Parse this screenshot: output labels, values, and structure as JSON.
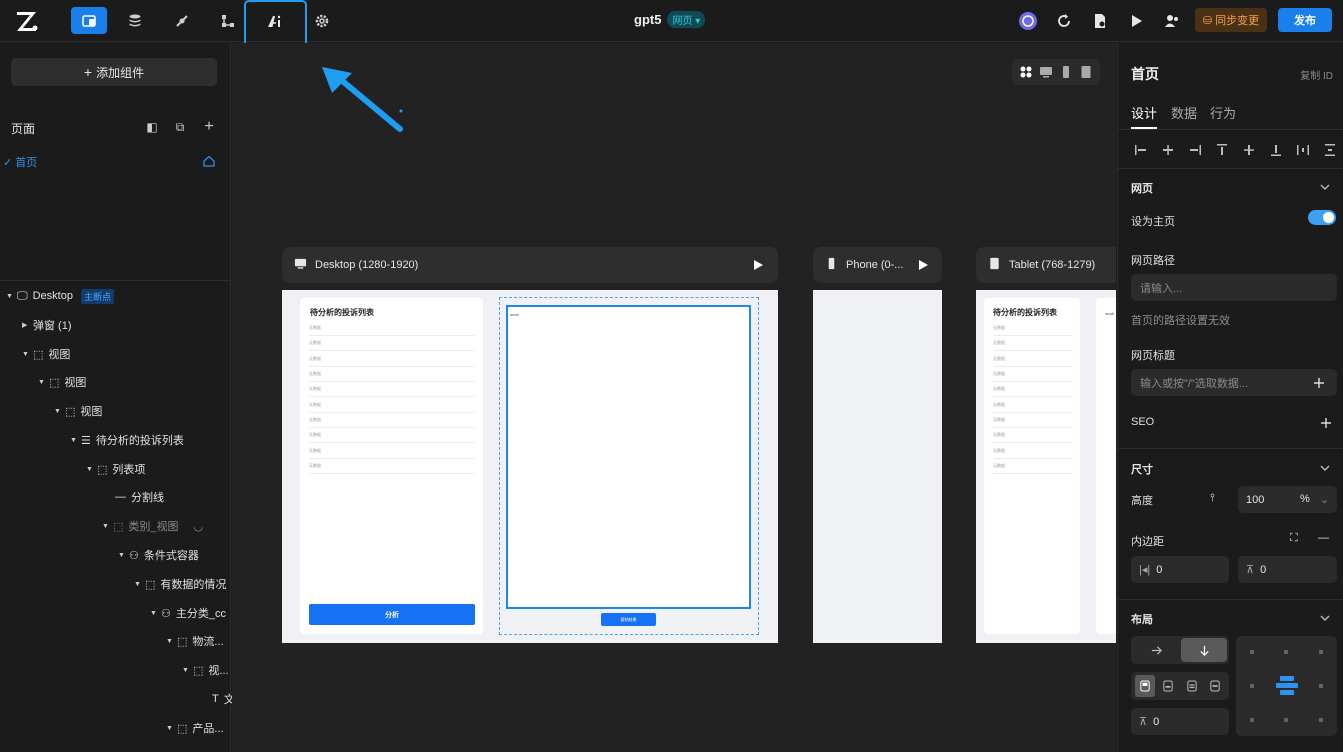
{
  "topbar": {
    "title": "gpt5",
    "title_badge": "网页",
    "sync_label": "同步变更",
    "publish_label": "发布",
    "tool_icons": [
      "pages-icon",
      "database-icon",
      "plugin-icon",
      "workflow-icon",
      "ai-icon",
      "settings-icon"
    ]
  },
  "left": {
    "add_component_label": "添加组件",
    "pages_heading": "页面",
    "current_page": "首页",
    "tree": [
      {
        "label": "Desktop",
        "badge": "主断点"
      },
      {
        "label": "弹窗 (1)"
      },
      {
        "label": "视图"
      },
      {
        "label": "视图"
      },
      {
        "label": "视图"
      },
      {
        "label": "待分析的投诉列表"
      },
      {
        "label": "列表项"
      },
      {
        "label": "分割线"
      },
      {
        "label": "类别_视图"
      },
      {
        "label": "条件式容器"
      },
      {
        "label": "有数据的情况"
      },
      {
        "label": "主分类_cc"
      },
      {
        "label": "物流..."
      },
      {
        "label": "视..."
      },
      {
        "label": "文"
      },
      {
        "label": "产品..."
      }
    ]
  },
  "canvas": {
    "frames": [
      {
        "label": "Desktop (1280-1920)"
      },
      {
        "label": "Phone (0-..."
      },
      {
        "label": "Tablet (768-1279)"
      }
    ],
    "card_title": "待分析的投诉列表",
    "row_placeholder": "无数据",
    "analyze_button": "分析",
    "result_text": "result",
    "copy_button": "复制结果"
  },
  "right": {
    "title": "首页",
    "copy_id": "复制 ID",
    "tabs": [
      "设计",
      "数据",
      "行为"
    ],
    "section_page": "网页",
    "set_home_label": "设为主页",
    "set_home_on": true,
    "path_label": "网页路径",
    "path_placeholder": "请输入...",
    "path_hint": "首页的路径设置无效",
    "page_title_label": "网页标题",
    "page_title_placeholder": "输入或按\"/\"选取数据...",
    "seo_label": "SEO",
    "section_size": "尺寸",
    "height_label": "高度",
    "height_value": "100",
    "height_unit": "%",
    "padding_label": "内边距",
    "padding_h": "0",
    "padding_v": "0",
    "section_layout": "布局",
    "gap_value": "0"
  },
  "colors": {
    "accent": "#1a7fe8",
    "highlight": "#1e9df1",
    "sync": "#f3a04a"
  }
}
